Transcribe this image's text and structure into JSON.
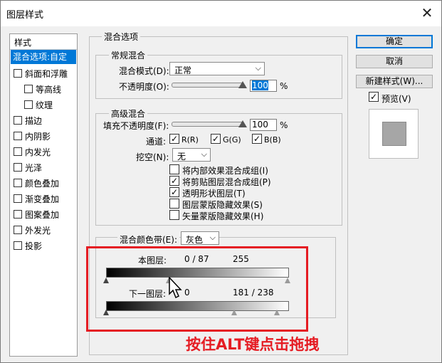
{
  "dialog": {
    "title": "图层样式",
    "close_glyph": "✕"
  },
  "style_list": {
    "header": "样式",
    "items": [
      {
        "label": "混合选项:自定",
        "selected": true,
        "checkbox": false
      },
      {
        "label": "斜面和浮雕",
        "checkbox": true
      },
      {
        "label": "等高线",
        "checkbox": true,
        "indent": true
      },
      {
        "label": "纹理",
        "checkbox": true,
        "indent": true
      },
      {
        "label": "描边",
        "checkbox": true
      },
      {
        "label": "内阴影",
        "checkbox": true
      },
      {
        "label": "内发光",
        "checkbox": true
      },
      {
        "label": "光泽",
        "checkbox": true
      },
      {
        "label": "颜色叠加",
        "checkbox": true
      },
      {
        "label": "渐变叠加",
        "checkbox": true
      },
      {
        "label": "图案叠加",
        "checkbox": true
      },
      {
        "label": "外发光",
        "checkbox": true
      },
      {
        "label": "投影",
        "checkbox": true
      }
    ]
  },
  "blend_options": {
    "title": "混合选项",
    "general": {
      "title": "常规混合",
      "mode_label": "混合模式(D):",
      "mode_value": "正常",
      "opacity_label": "不透明度(O):",
      "opacity_value": "100",
      "percent": "%"
    },
    "advanced": {
      "title": "高级混合",
      "fill_label": "填充不透明度(F):",
      "fill_value": "100",
      "percent": "%",
      "channels_label": "通道:",
      "channels": [
        {
          "label": "R(R)",
          "checked": true
        },
        {
          "label": "G(G)",
          "checked": true
        },
        {
          "label": "B(B)",
          "checked": true
        }
      ],
      "knockout_label": "挖空(N):",
      "knockout_value": "无",
      "options": [
        {
          "label": "将内部效果混合成组(I)",
          "checked": false
        },
        {
          "label": "将剪贴图层混合成组(P)",
          "checked": true
        },
        {
          "label": "透明形状图层(T)",
          "checked": true
        },
        {
          "label": "图层蒙版隐藏效果(S)",
          "checked": false
        },
        {
          "label": "矢量蒙版隐藏效果(H)",
          "checked": false
        }
      ]
    },
    "blend_if": {
      "label": "混合颜色带(E):",
      "value": "灰色",
      "this_layer_label": "本图层:",
      "this_layer_values": "0 / 87",
      "this_layer_max": "255",
      "underlying_label": "下一图层:",
      "underlying_min": "0",
      "underlying_values": "181 / 238"
    }
  },
  "buttons": {
    "ok": "确定",
    "cancel": "取消",
    "new_style": "新建样式(W)...",
    "preview_label": "预览(V)",
    "preview_checked": true
  },
  "annotation": {
    "text": "按住ALT键点击拖拽",
    "color": "#e51c23"
  },
  "colors": {
    "selection": "#0078d7",
    "dialog_bg": "#f0f0f0"
  }
}
